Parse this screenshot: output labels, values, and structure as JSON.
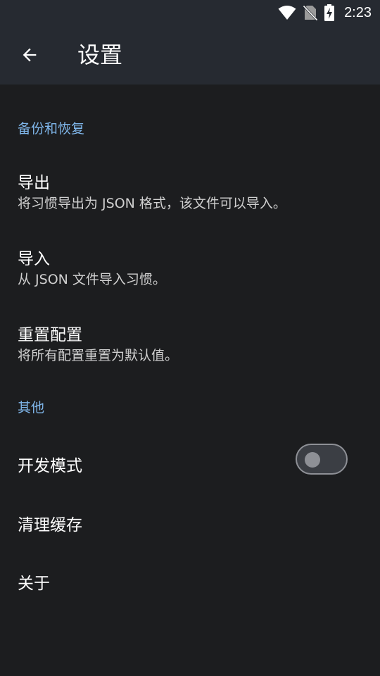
{
  "status_bar": {
    "time": "2:23",
    "icons": [
      "wifi-icon",
      "no-sim-icon",
      "battery-charging-icon"
    ]
  },
  "toolbar": {
    "back_icon": "arrow-back-icon",
    "title": "设置"
  },
  "sections": {
    "backup": {
      "header": "备份和恢复",
      "export": {
        "title": "导出",
        "summary": "将习惯导出为 JSON 格式，该文件可以导入。"
      },
      "import": {
        "title": "导入",
        "summary": "从 JSON 文件导入习惯。"
      },
      "reset": {
        "title": "重置配置",
        "summary": "将所有配置重置为默认值。"
      }
    },
    "other": {
      "header": "其他",
      "dev_mode": {
        "title": "开发模式",
        "enabled": false
      },
      "clear_cache": {
        "title": "清理缓存"
      },
      "about": {
        "title": "关于"
      }
    }
  },
  "colors": {
    "background": "#1c1d1f",
    "toolbar": "#262a31",
    "accent": "#7fb6ea",
    "switch_off": "#8e9096"
  }
}
